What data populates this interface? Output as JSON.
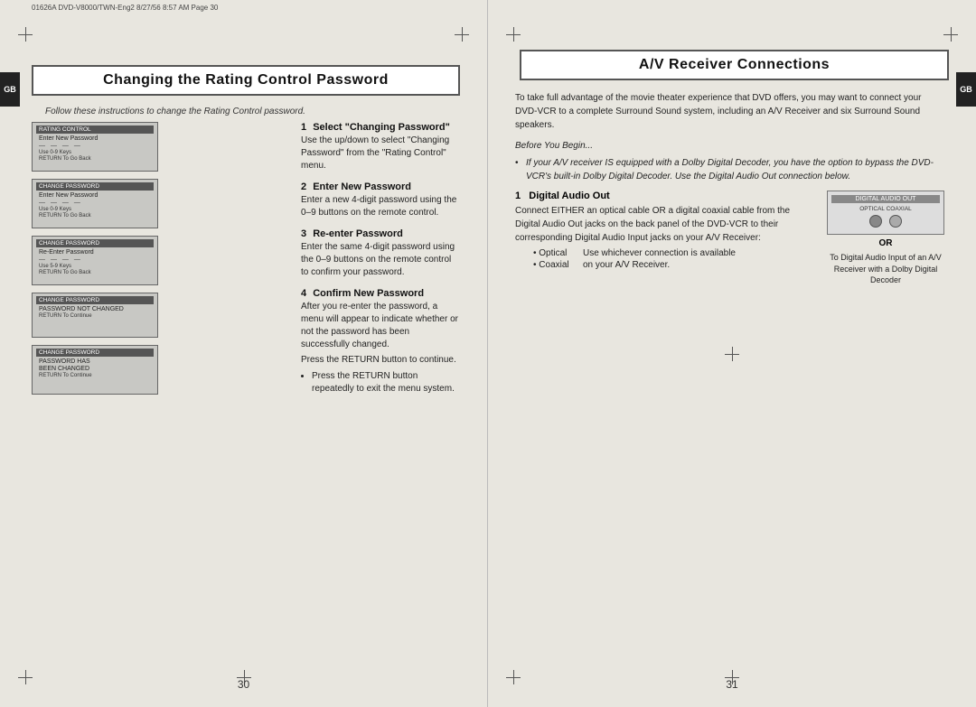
{
  "left_page": {
    "meta": "01626A DVD-V8000/TWN-Eng2  8/27/56  8:57 AM  Page 30",
    "tab_label": "GB",
    "header_title": "Changing the Rating Control Password",
    "intro_italic": "Follow these instructions to change the Rating Control password.",
    "steps": [
      {
        "number": "1",
        "heading": "Select \"Changing Password\"",
        "text": "Use the up/down to select \"Changing Password\" from the \"Rating Control\" menu."
      },
      {
        "number": "2",
        "heading": "Enter New Password",
        "text": "Enter a new 4-digit password using the 0–9 buttons on the remote control."
      },
      {
        "number": "3",
        "heading": "Re-enter Password",
        "text": "Enter the same 4-digit password using the 0–9 buttons on the remote control to confirm your password."
      },
      {
        "number": "4",
        "heading": "Confirm New Password",
        "text": "After you re-enter the password, a menu will appear to indicate whether or not the password has been successfully changed.",
        "sub_text": "Press the RETURN button to continue.",
        "bullet": "Press the RETURN button repeatedly to exit the menu system."
      }
    ],
    "page_number": "30",
    "screens": [
      {
        "title": "RATING CONTROL",
        "lines": [
          "Enter New Password",
          "— — — —",
          "Use 0-9 Keys",
          "RETURN To Go Back"
        ]
      },
      {
        "title": "CHANGE PASSWORD",
        "lines": [
          "Enter New Password",
          "— — — —",
          "Use 0-9 Keys",
          "RETURN To Go Back"
        ]
      },
      {
        "title": "CHANGE PASSWORD",
        "lines": [
          "Re-Enter Password",
          "— — — —",
          "Use 5-9 Keys",
          "RETURN To Go Back"
        ]
      },
      {
        "title": "CHANGE PASSWORD",
        "lines": [
          "PASSWORD NOT CHANGED",
          "",
          "RETURN To Continue"
        ]
      },
      {
        "title": "CHANGE PASSWORD",
        "lines": [
          "PASSWORD HAS",
          "BEEN CHANGED",
          "RETURN To Continue"
        ]
      }
    ]
  },
  "right_page": {
    "tab_label": "GB",
    "header_title": "A/V Receiver Connections",
    "intro_text": "To take full advantage of the movie theater experience that DVD offers, you may want to connect your DVD-VCR to a complete Surround Sound system, including an A/V Receiver and six Surround Sound speakers.",
    "before_begin": "Before You Begin...",
    "bullet_italic": "If your A/V receiver IS equipped with a Dolby Digital Decoder, you have the option to bypass the DVD-VCR's built-in Dolby Digital Decoder. Use the Digital Audio Out connection below.",
    "step": {
      "number": "1",
      "heading": "Digital Audio Out",
      "text": "Connect EITHER an optical cable OR a digital coaxial cable from the Digital Audio Out jacks on the back panel of the DVD-VCR to their corresponding Digital Audio Input jacks on your A/V Receiver:",
      "bullets": [
        {
          "label": "• Optical",
          "text": "Use whichever connection is available"
        },
        {
          "label": "• Coaxial",
          "text": "on your A/V Receiver."
        }
      ]
    },
    "diagram": {
      "title": "DIGITAL AUDIO OUT",
      "subtitle": "OPTICAL   COAXIAL",
      "or_label": "OR",
      "caption": "To Digital Audio Input of an A/V Receiver with a Dolby Digital Decoder"
    },
    "page_number": "31"
  }
}
